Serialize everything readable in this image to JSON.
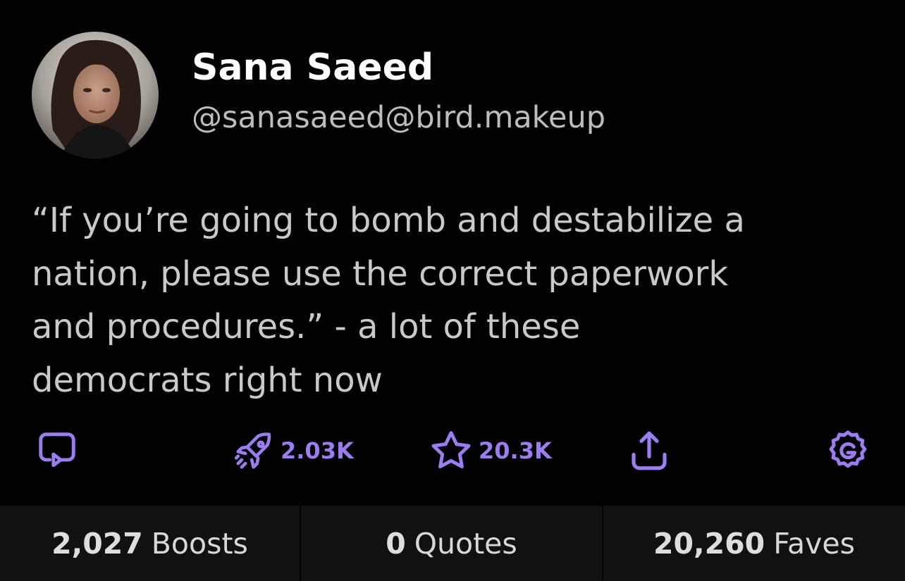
{
  "author": {
    "display_name": "Sana Saeed",
    "handle": "@sanasaeed@bird.makeup"
  },
  "post": {
    "lines": [
      "“If you’re going to bomb and destabilize a",
      "nation, please use the correct paperwork",
      "and procedures.” - a lot of these",
      "democrats right now"
    ]
  },
  "actions": {
    "reply_icon": "reply-icon",
    "boost_icon": "rocket-icon",
    "boost_count": "2.03K",
    "fave_icon": "star-icon",
    "fave_count": "20.3K",
    "share_icon": "share-icon",
    "more_icon": "gear-icon"
  },
  "stats": {
    "boosts_value": "2,027",
    "boosts_label": "Boosts",
    "quotes_value": "0",
    "quotes_label": "Quotes",
    "faves_value": "20,260",
    "faves_label": "Faves"
  },
  "colors": {
    "background": "#000000",
    "accent": "#9d7cf0",
    "stats_bar": "#111111",
    "text": "#c9c9c9"
  }
}
